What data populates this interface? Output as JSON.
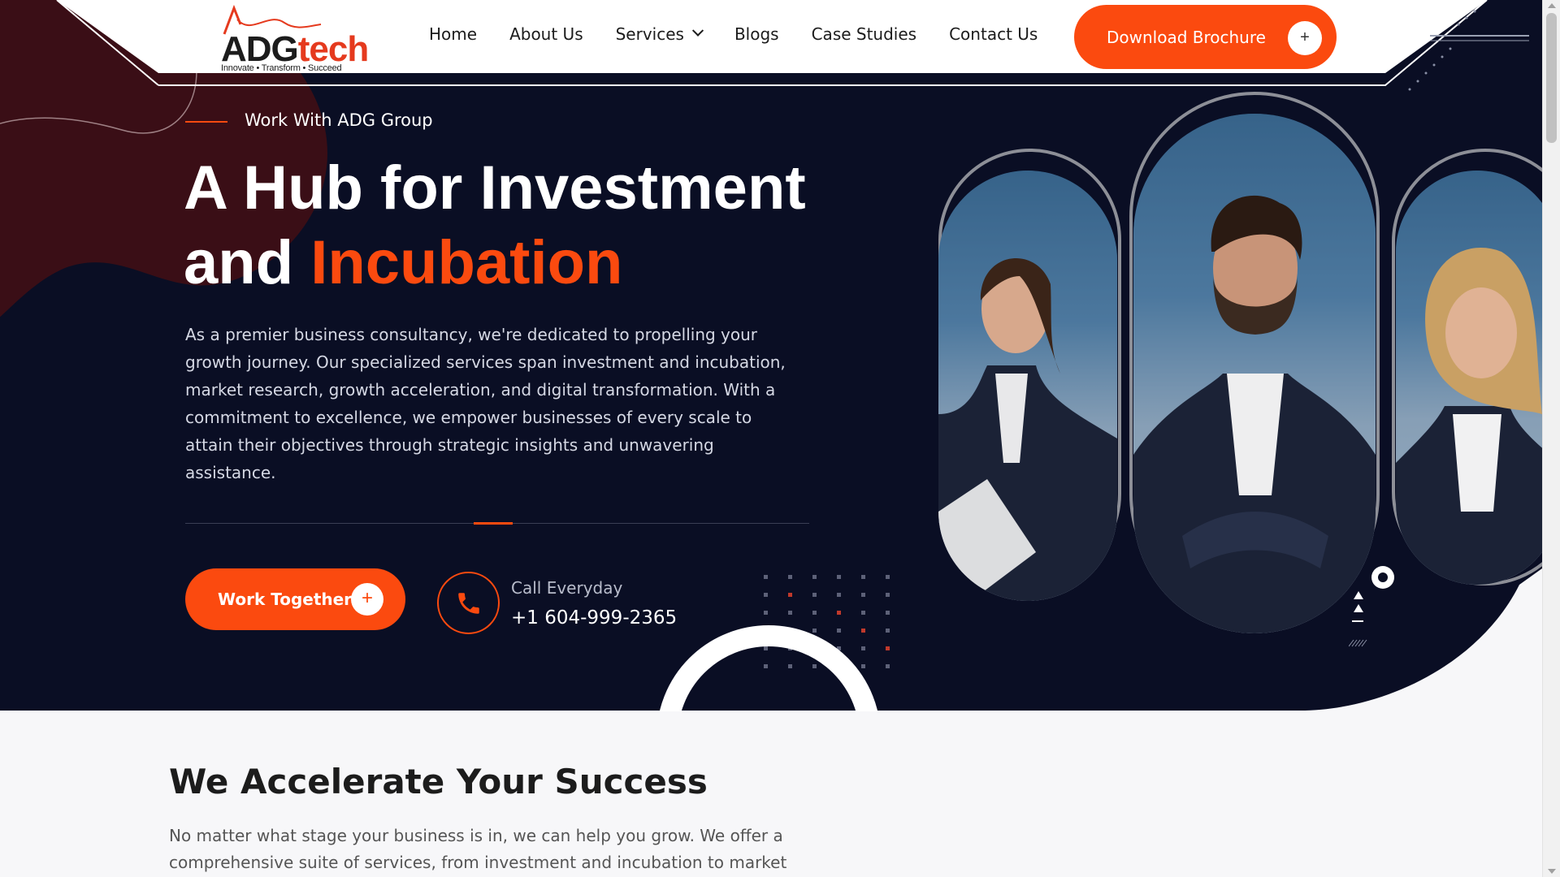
{
  "brand": {
    "name_main": "ADG",
    "name_accent": "tech",
    "tagline": "Innovate • Transform • Succeed"
  },
  "nav": {
    "items": [
      {
        "label": "Home"
      },
      {
        "label": "About Us"
      },
      {
        "label": "Services",
        "has_dropdown": true
      },
      {
        "label": "Blogs"
      },
      {
        "label": "Case Studies"
      },
      {
        "label": "Contact Us"
      }
    ],
    "cta_label": "Download Brochure",
    "cta_icon": "+"
  },
  "hero": {
    "eyebrow": "Work With ADG Group",
    "title_line1": "A Hub for Investment",
    "title_line2_plain": "and ",
    "title_line2_accent": "Incubation",
    "description": "As a premier business consultancy, we're dedicated to propelling your growth journey. Our specialized services span investment and incubation, market research, growth acceleration, and digital transformation. With a commitment to excellence, we empower businesses of every scale to attain their objectives through strategic insights and unwavering assistance.",
    "cta_label": "Work Together",
    "cta_icon": "+",
    "call_label": "Call Everyday",
    "call_phone": "+1 604-999-2365"
  },
  "section": {
    "title": "We Accelerate Your Success",
    "description": "No matter what stage your business is in, we can help you grow. We offer a comprehensive suite of services, from investment and incubation to market research"
  },
  "colors": {
    "accent": "#fb4a0f",
    "dark_bg": "#0a0e24",
    "text_light": "#d5d8e4"
  }
}
